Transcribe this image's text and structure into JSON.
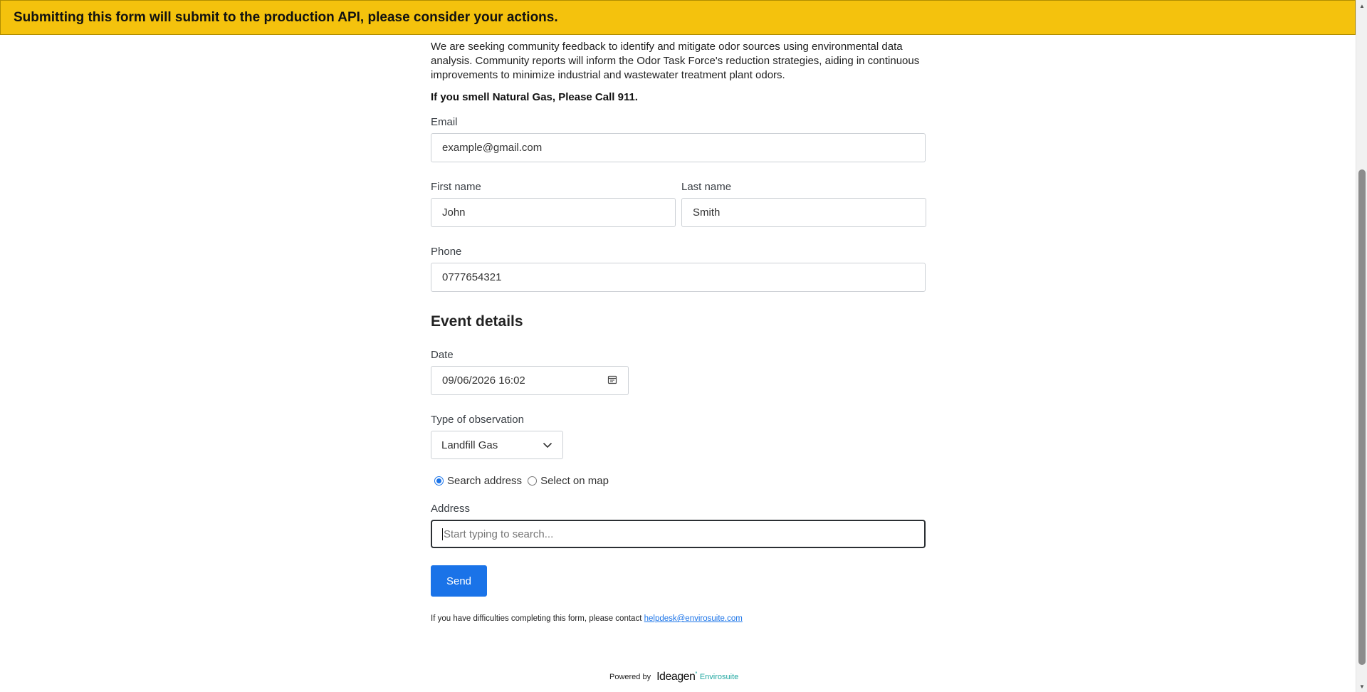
{
  "banner": {
    "text": "Submitting this form will submit to the production API, please consider your actions."
  },
  "intro": {
    "text": "We are seeking community feedback to identify and mitigate odor sources using environmental data analysis. Community reports will inform the Odor Task Force's reduction strategies, aiding in continuous improvements to minimize industrial and wastewater treatment plant odors.",
    "warning": "If you smell Natural Gas, Please Call 911."
  },
  "form": {
    "email": {
      "label": "Email",
      "value": "example@gmail.com"
    },
    "first_name": {
      "label": "First name",
      "value": "John"
    },
    "last_name": {
      "label": "Last name",
      "value": "Smith"
    },
    "phone": {
      "label": "Phone",
      "value": "0777654321"
    },
    "event_section": "Event details",
    "date": {
      "label": "Date",
      "value": "09/06/2026 16:02",
      "icon": "calendar-icon"
    },
    "observation": {
      "label": "Type of observation",
      "value": "Landfill Gas",
      "icon": "chevron-down-icon"
    },
    "location_mode": {
      "options": [
        "Search address",
        "Select on map"
      ],
      "selected": "Search address"
    },
    "address": {
      "label": "Address",
      "placeholder": "Start typing to search..."
    },
    "send_label": "Send"
  },
  "help": {
    "text": "If you have difficulties completing this form, please contact ",
    "email": "helpdesk@envirosuite.com"
  },
  "footer": {
    "powered_by": "Powered by",
    "logo_main": "Ideagen",
    "logo_sub": "Envirosuite"
  },
  "colors": {
    "banner": "#f4c20d",
    "accent": "#1a73e8",
    "brand_teal": "#1fa7a0"
  }
}
